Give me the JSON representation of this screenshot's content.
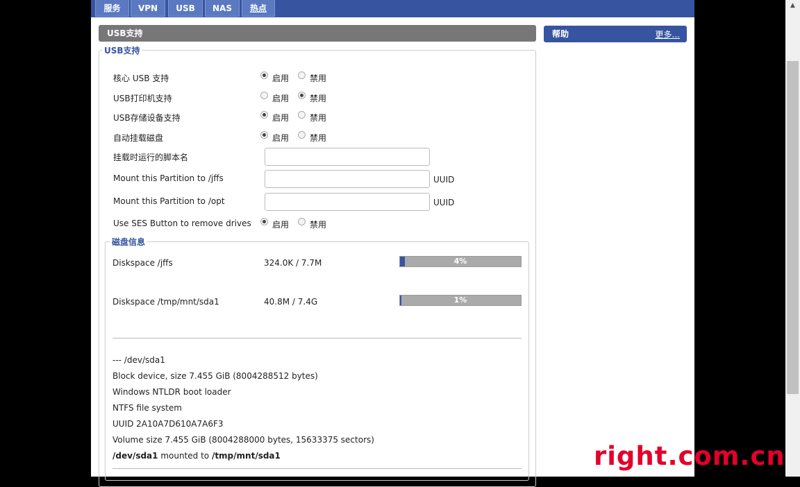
{
  "tabs": [
    "服务",
    "VPN",
    "USB",
    "NAS",
    "热点"
  ],
  "section_title": "USB支持",
  "help": {
    "title": "帮助",
    "more": "更多..."
  },
  "usb_fieldset_legend": "USB支持",
  "options": [
    {
      "label": "核心 USB 支持",
      "enable": "启用",
      "disable": "禁用",
      "selected": "enable"
    },
    {
      "label": "USB打印机支持",
      "enable": "启用",
      "disable": "禁用",
      "selected": "disable"
    },
    {
      "label": "USB存储设备支持",
      "enable": "启用",
      "disable": "禁用",
      "selected": "enable"
    },
    {
      "label": "自动挂载磁盘",
      "enable": "启用",
      "disable": "禁用",
      "selected": "enable"
    }
  ],
  "script_name": {
    "label": "挂载时运行的脚本名",
    "value": ""
  },
  "mount_jffs": {
    "label": "Mount this Partition to /jffs",
    "value": "",
    "suffix": "UUID"
  },
  "mount_opt": {
    "label": "Mount this Partition to /opt",
    "value": "",
    "suffix": "UUID"
  },
  "ses_button": {
    "label": "Use SES Button to remove drives",
    "enable": "启用",
    "disable": "禁用",
    "selected": "enable"
  },
  "disk_info": {
    "legend": "磁盘信息",
    "items": [
      {
        "label": "Diskspace /jffs",
        "value": "324.0K / 7.7M",
        "percent_text": "4%",
        "percent": 4
      },
      {
        "label": "Diskspace /tmp/mnt/sda1",
        "value": "40.8M / 7.4G",
        "percent_text": "1%",
        "percent": 1
      }
    ],
    "device_lines": [
      "--- /dev/sda1",
      "Block device, size 7.455 GiB (8004288512 bytes)",
      "Windows NTLDR boot loader",
      "NTFS file system",
      "UUID 2A10A7D610A7A6F3",
      "Volume size 7.455 GiB (8004288000 bytes, 15633375 sectors)"
    ],
    "mount_line": {
      "device": "/dev/sda1",
      "middle": " mounted to ",
      "target": "/tmp/mnt/sda1"
    }
  },
  "watermark": "right.com.cn"
}
